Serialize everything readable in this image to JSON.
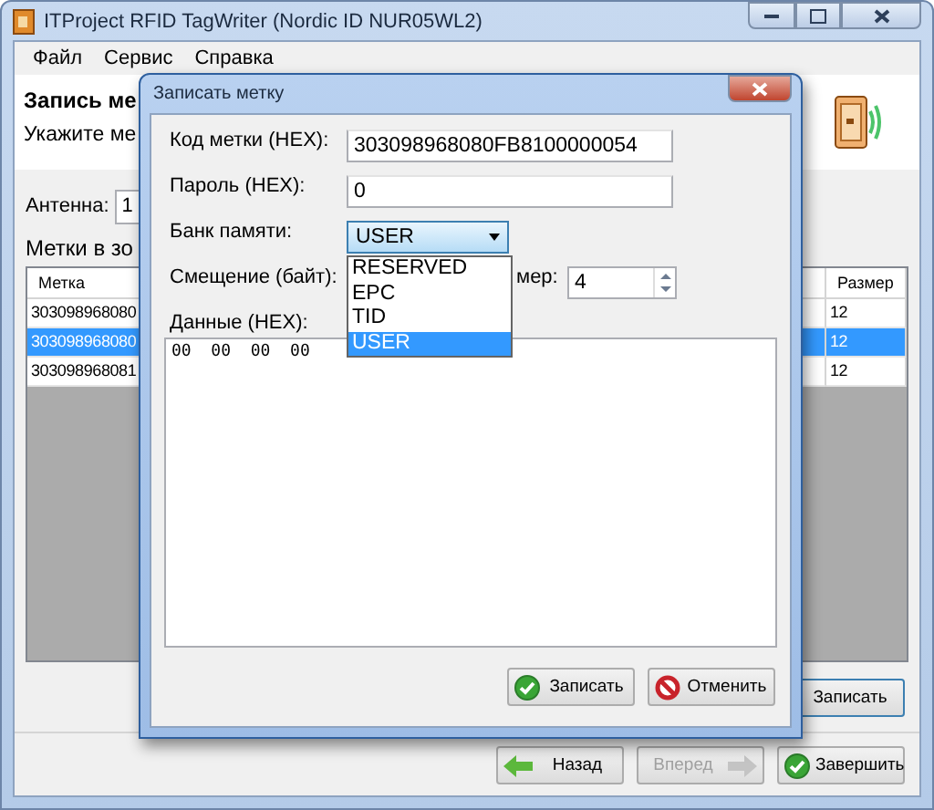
{
  "window": {
    "title": "ITProject RFID TagWriter (Nordic ID NUR05WL2)"
  },
  "menu": [
    {
      "label": "Файл"
    },
    {
      "label": "Сервис"
    },
    {
      "label": "Справка"
    }
  ],
  "header": {
    "title": "Запись ме",
    "subtitle": "Укажите ме"
  },
  "antenna": {
    "label": "Антенна:",
    "value": "1"
  },
  "tags": {
    "label": "Метки в зо",
    "columns": [
      "Метка",
      "Размер"
    ],
    "rows": [
      {
        "tag": "303098968080",
        "size": "12",
        "selected": false
      },
      {
        "tag": "303098968080",
        "size": "12",
        "selected": true
      },
      {
        "tag": "303098968081",
        "size": "12",
        "selected": false
      }
    ]
  },
  "write_button": {
    "label": "Записать"
  },
  "nav_buttons": [
    {
      "label": "Назад",
      "kind": "back",
      "disabled": false
    },
    {
      "label": "Вперед",
      "kind": "forward",
      "disabled": true
    },
    {
      "label": "Завершить",
      "kind": "finish",
      "disabled": false
    }
  ],
  "dialog": {
    "title": "Записать метку",
    "tag_code": {
      "label": "Код метки (HEX):",
      "value": "303098968080FB8100000054"
    },
    "password": {
      "label": "Пароль (HEX):",
      "value": "0"
    },
    "memory_bank": {
      "label": "Банк памяти:",
      "value": "USER",
      "expanded": true,
      "options": [
        {
          "label": "RESERVED",
          "selected": false
        },
        {
          "label": "EPC",
          "selected": false
        },
        {
          "label": "TID",
          "selected": false
        },
        {
          "label": "USER",
          "selected": true
        }
      ]
    },
    "offset": {
      "label": "Смещение (байт):"
    },
    "size": {
      "label": "мер:",
      "value": "4"
    },
    "data": {
      "label": "Данные (HEX):",
      "value": "00  00  00  00"
    },
    "buttons": [
      {
        "label": "Записать",
        "kind": "ok"
      },
      {
        "label": "Отменить",
        "kind": "cancel"
      }
    ]
  }
}
